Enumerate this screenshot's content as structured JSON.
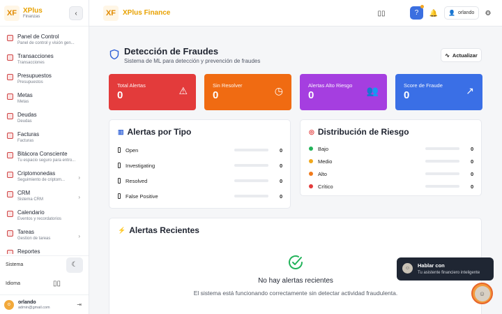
{
  "sidebar": {
    "brand_logo": "XF",
    "brand_name": "XPlus",
    "brand_sub": "Finanzas",
    "collapse_icon": "‹",
    "items": [
      {
        "label": "Panel de Control",
        "sub": "Panel de control y visión gen...",
        "chevron": ""
      },
      {
        "label": "Transacciones",
        "sub": "Transacciones",
        "chevron": ""
      },
      {
        "label": "Presupuestos",
        "sub": "Presupuestos",
        "chevron": ""
      },
      {
        "label": "Metas",
        "sub": "Metas",
        "chevron": ""
      },
      {
        "label": "Deudas",
        "sub": "Deudas",
        "chevron": ""
      },
      {
        "label": "Facturas",
        "sub": "Facturas",
        "chevron": ""
      },
      {
        "label": "Bitácora Consciente",
        "sub": "Tu espacio seguro para entro...",
        "chevron": ""
      },
      {
        "label": "Criptomonedas",
        "sub": "Seguimiento de criptom...",
        "chevron": "›"
      },
      {
        "label": "CRM",
        "sub": "Sistema CRM",
        "chevron": "›"
      },
      {
        "label": "Calendario",
        "sub": "Eventos y recordatorios",
        "chevron": ""
      },
      {
        "label": "Tareas",
        "sub": "Gestion de tareas",
        "chevron": "›"
      },
      {
        "label": "Reportes",
        "sub": "",
        "chevron": ""
      }
    ],
    "system_label": "Sistema",
    "theme_icon": "☾",
    "language_label": "Idioma",
    "language_icon": "▯▯",
    "user": {
      "initial": "o",
      "name": "orlando",
      "email": "admin@gmail.com"
    },
    "logout_icon": "⇥"
  },
  "header": {
    "logo": "XF",
    "title": "XPlus Finance",
    "layout_icon": "▯▯",
    "help_icon": "?",
    "bell_icon": "🔔",
    "user_icon": "👤",
    "user_name": "orlando",
    "settings_icon": "⚙"
  },
  "page": {
    "title": "Detección de Fraudes",
    "subtitle": "Sistema de ML para detección y prevención de fraudes",
    "refresh_icon": "∿",
    "refresh_label": "Actualizar"
  },
  "stats": [
    {
      "label": "Total Alertas",
      "value": "0",
      "icon": "⚠",
      "color": "#e33b3b"
    },
    {
      "label": "Sin Resolver",
      "value": "0",
      "icon": "◷",
      "color": "#f06b12"
    },
    {
      "label": "Alertas Alto Riesgo",
      "value": "0",
      "icon": "👥",
      "color": "#a53ee0"
    },
    {
      "label": "Score de Fraude",
      "value": "0",
      "icon": "↗",
      "color": "#3a6fe6"
    }
  ],
  "alert_types": {
    "title": "Alertas por Tipo",
    "icon": "▥",
    "rows": [
      {
        "label": "Open",
        "value": "0",
        "fraction": 0
      },
      {
        "label": "Investigating",
        "value": "0",
        "fraction": 0
      },
      {
        "label": "Resolved",
        "value": "0",
        "fraction": 0
      },
      {
        "label": "False Positive",
        "value": "0",
        "fraction": 0
      }
    ]
  },
  "risk": {
    "title": "Distribución de Riesgo",
    "icon": "◎",
    "rows": [
      {
        "label": "Bajo",
        "value": "0",
        "color": "#22b35a",
        "fraction": 0
      },
      {
        "label": "Medio",
        "value": "0",
        "color": "#f0a81c",
        "fraction": 0
      },
      {
        "label": "Alto",
        "value": "0",
        "color": "#f07a1c",
        "fraction": 0
      },
      {
        "label": "Crítico",
        "value": "0",
        "color": "#e33b3b",
        "fraction": 0
      }
    ]
  },
  "recent": {
    "title": "Alertas Recientes",
    "icon": "⚡",
    "empty_title": "No hay alertas recientes",
    "empty_sub": "El sistema está funcionando correctamente sin detectar actividad fraudulenta."
  },
  "chat": {
    "title": "Hablar con",
    "sub": "Tu asistente financiero inteligente",
    "avatar": "☺"
  }
}
